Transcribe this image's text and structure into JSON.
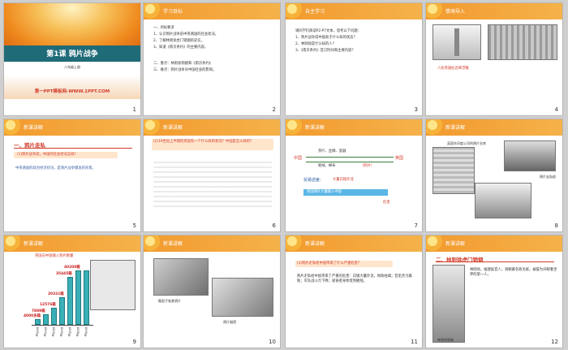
{
  "slides": [
    {
      "n": "1",
      "title": "第1课  鸦片战争",
      "subtitle": "八年级上册",
      "footer": "第一PPT模板网-WWW.1PPT.COM"
    },
    {
      "n": "2",
      "header": "学习目标",
      "lines": [
        "一、目标要求",
        "1、认识鸦片战争前中英两国的社会状况。",
        "2、了解林则徐虎门销烟的史实。",
        "3、知道《南京条约》的主要内容。",
        "二、重点：林则徐销烟和《南京条约》",
        "三、难点：鸦片战争对中国社会的影响。"
      ]
    },
    {
      "n": "3",
      "header": "自主学习",
      "lines": [
        "请同学们阅读P2-P7文本，思考以下问题：",
        "1、鸦片战争前中国处于什么样的状态？",
        "2、林则徐是什么样的人？",
        "3、《南京条约》签订时间和主要内容？"
      ]
    },
    {
      "n": "4",
      "header": "情境导入",
      "caption": "人民英雄纪念碑浮雕"
    },
    {
      "n": "5",
      "header": "新课讲解",
      "section": "一、鸦片走私",
      "question": "(1)鸦片战争前，中国的社会状况怎样？",
      "body": "中英两国的政治经济状况，是鸦片战争爆发的背景。"
    },
    {
      "n": "6",
      "header": "新课讲解",
      "question": "(2)19世纪上半期的英国有一个什么样的状况？中国是怎么样的？"
    },
    {
      "n": "7",
      "header": "新课讲解",
      "china": "中国",
      "britain": "英国",
      "goods_top": "茶叶、丝绸、瓷器",
      "goods_bottom": "呢绒、棉布",
      "tag1": "（鸦片）",
      "result_label": "贸易逆差：",
      "result_text": "大量白银外流",
      "box": "英国鸦片大量输入中国",
      "tag2": "危害"
    },
    {
      "n": "8",
      "header": "新课讲解",
      "cap1": "英国东印度公司的鸦片仓库",
      "cap2": "鸦片走私船"
    },
    {
      "n": "9",
      "header": "新课讲解",
      "chart_title": "英国向中国输入鸦片数量",
      "chart_img_title": "鸦片走私数量"
    },
    {
      "n": "10",
      "header": "新课讲解",
      "cap1": "瘾君子吸食鸦片",
      "cap2": "鸦片烟馆"
    },
    {
      "n": "11",
      "header": "新课讲解",
      "question": "(3)鸦片走私给中国带来了什么严重危害？",
      "body": "鸦片走私给中国带来了严重的危害：白银大量外流，财政枯竭；官吏贪污腐败；军队战斗力下降；吸食者身体受到摧残。"
    },
    {
      "n": "12",
      "header": "新课讲解",
      "section": "二、林则徐虎门销烟",
      "text": "林则徐，福建侯官人，清朝著名政治家，被誉为开眼看世界的第一人。",
      "caption": "林则徐塑像"
    }
  ],
  "chart_data": {
    "type": "bar",
    "title": "英国向中国输入鸦片数量",
    "categories": [
      "1800年",
      "1810年",
      "1820年",
      "1830年",
      "1835年",
      "1838年",
      "1839年"
    ],
    "values": [
      4000,
      7889,
      12576,
      20331,
      35445,
      40200,
      40200
    ],
    "labels": [
      "4000多箱",
      "7889箱",
      "12576箱",
      "20331箱",
      "35445箱",
      "40200箱"
    ],
    "ylim": [
      0,
      42000
    ]
  },
  "colors": {
    "header": "#f29a2e",
    "accent": "#d23c2a",
    "bar": "#3ab0b8"
  }
}
